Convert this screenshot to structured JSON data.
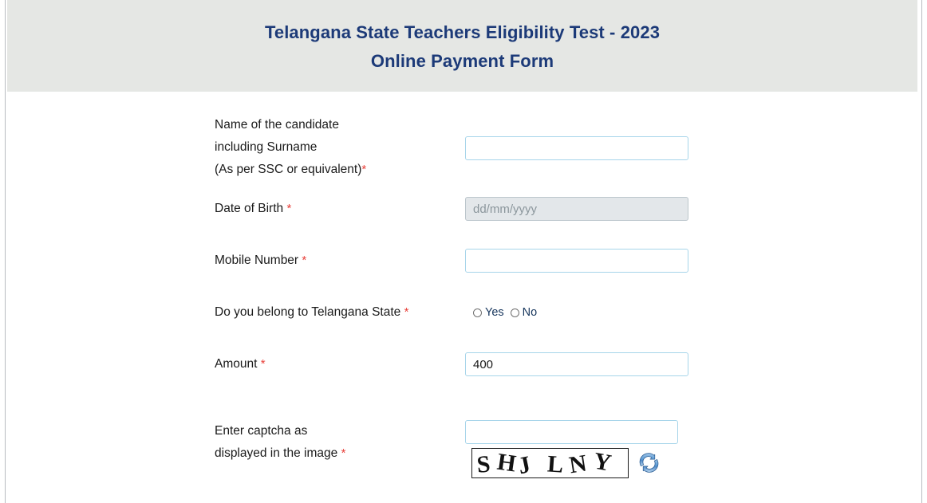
{
  "header": {
    "title": "Telangana State Teachers Eligibility Test - 2023",
    "subtitle": "Online Payment Form",
    "background_color": "#e5e7e4",
    "title_color": "#1c3a78"
  },
  "form": {
    "required_marker": "*",
    "fields": {
      "name": {
        "label_line1": "Name of the candidate",
        "label_line2": "including Surname",
        "label_line3": "(As per SSC or equivalent)",
        "value": "",
        "placeholder": ""
      },
      "dob": {
        "label": "Date of Birth",
        "value": "",
        "placeholder": "dd/mm/yyyy"
      },
      "mobile": {
        "label": "Mobile Number",
        "value": "",
        "placeholder": ""
      },
      "telangana": {
        "label": "Do you belong to Telangana State",
        "options": [
          {
            "label": "Yes",
            "selected": false
          },
          {
            "label": "No",
            "selected": false
          }
        ]
      },
      "amount": {
        "label": "Amount",
        "value": "400",
        "placeholder": ""
      },
      "captcha": {
        "label_line1": "Enter captcha as",
        "label_line2": "displayed in the image",
        "value": "",
        "placeholder": "",
        "image_text": "SHJLNY",
        "refresh_icon": "refresh-icon"
      }
    }
  },
  "colors": {
    "input_border": "#a7d5ea",
    "disabled_background": "#e3e7ea",
    "required_asterisk": "#e8403a",
    "refresh_icon_blue": "#5b9bd5"
  }
}
